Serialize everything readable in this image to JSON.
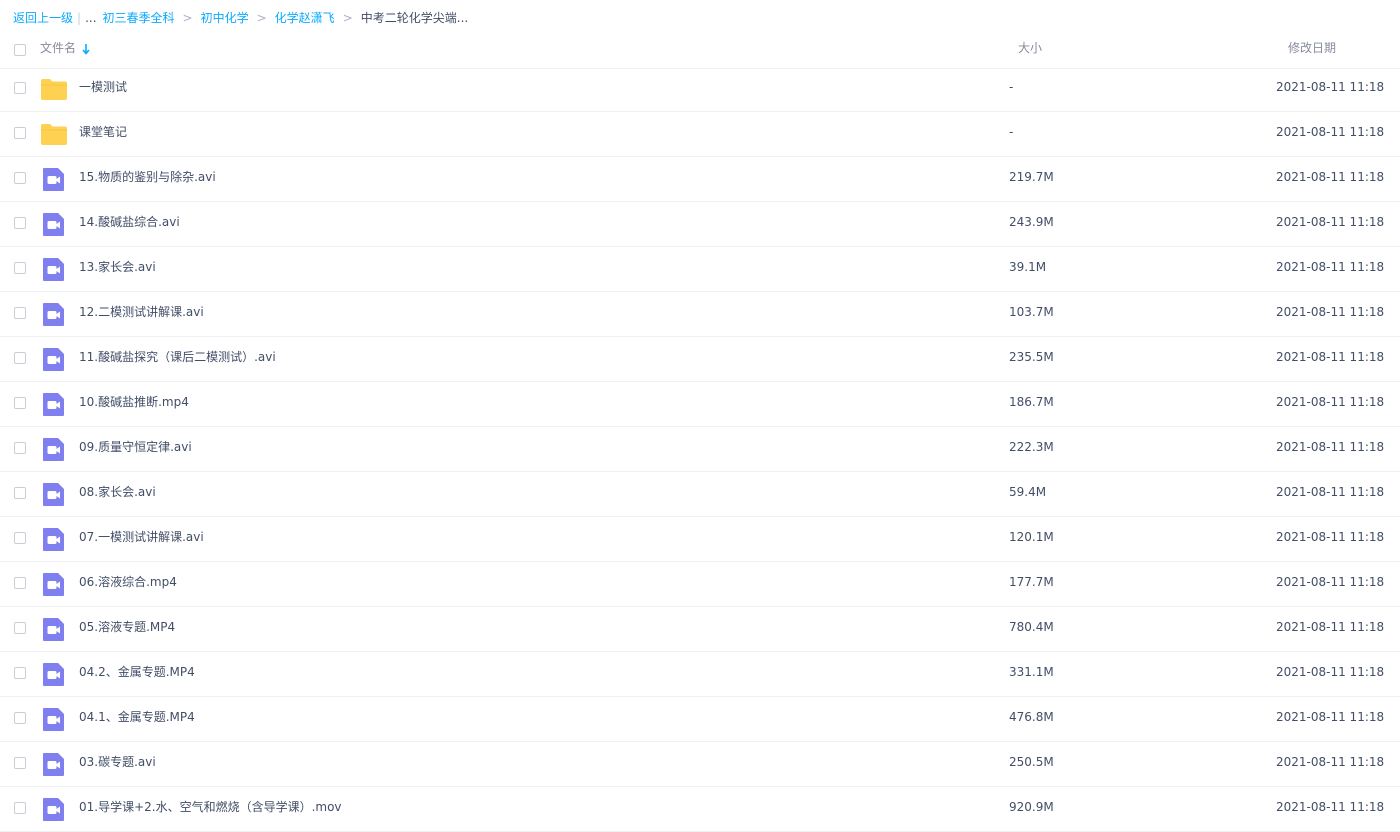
{
  "breadcrumb": {
    "back": "返回上一级",
    "separator_bar": "|",
    "ellipsis": "...",
    "sep": ">",
    "crumbs": [
      "初三春季全科",
      "初中化学",
      "化学赵潇飞"
    ],
    "current": "中考二轮化学尖端..."
  },
  "header": {
    "name": "文件名",
    "size": "大小",
    "date": "修改日期"
  },
  "colors": {
    "folder": "#ffd152",
    "video": "#7f7fef",
    "link": "#09aaff"
  },
  "files": [
    {
      "type": "folder",
      "icon": "folder-icon",
      "name": "一模测试",
      "size": "-",
      "date": "2021-08-11 11:18"
    },
    {
      "type": "folder",
      "icon": "folder-icon",
      "name": "课堂笔记",
      "size": "-",
      "date": "2021-08-11 11:18"
    },
    {
      "type": "video",
      "icon": "video-icon",
      "name": "15.物质的鉴别与除杂.avi",
      "size": "219.7M",
      "date": "2021-08-11 11:18"
    },
    {
      "type": "video",
      "icon": "video-icon",
      "name": "14.酸碱盐综合.avi",
      "size": "243.9M",
      "date": "2021-08-11 11:18"
    },
    {
      "type": "video",
      "icon": "video-icon",
      "name": "13.家长会.avi",
      "size": "39.1M",
      "date": "2021-08-11 11:18"
    },
    {
      "type": "video",
      "icon": "video-icon",
      "name": "12.二模测试讲解课.avi",
      "size": "103.7M",
      "date": "2021-08-11 11:18"
    },
    {
      "type": "video",
      "icon": "video-icon",
      "name": "11.酸碱盐探究（课后二模测试）.avi",
      "size": "235.5M",
      "date": "2021-08-11 11:18"
    },
    {
      "type": "video",
      "icon": "video-icon",
      "name": "10.酸碱盐推断.mp4",
      "size": "186.7M",
      "date": "2021-08-11 11:18"
    },
    {
      "type": "video",
      "icon": "video-icon",
      "name": "09.质量守恒定律.avi",
      "size": "222.3M",
      "date": "2021-08-11 11:18"
    },
    {
      "type": "video",
      "icon": "video-icon",
      "name": "08.家长会.avi",
      "size": "59.4M",
      "date": "2021-08-11 11:18"
    },
    {
      "type": "video",
      "icon": "video-icon",
      "name": "07.一模测试讲解课.avi",
      "size": "120.1M",
      "date": "2021-08-11 11:18"
    },
    {
      "type": "video",
      "icon": "video-icon",
      "name": "06.溶液综合.mp4",
      "size": "177.7M",
      "date": "2021-08-11 11:18"
    },
    {
      "type": "video",
      "icon": "video-icon",
      "name": "05.溶液专题.MP4",
      "size": "780.4M",
      "date": "2021-08-11 11:18"
    },
    {
      "type": "video",
      "icon": "video-icon",
      "name": "04.2、金属专题.MP4",
      "size": "331.1M",
      "date": "2021-08-11 11:18"
    },
    {
      "type": "video",
      "icon": "video-icon",
      "name": "04.1、金属专题.MP4",
      "size": "476.8M",
      "date": "2021-08-11 11:18"
    },
    {
      "type": "video",
      "icon": "video-icon",
      "name": "03.碳专题.avi",
      "size": "250.5M",
      "date": "2021-08-11 11:18"
    },
    {
      "type": "video",
      "icon": "video-icon",
      "name": "01.导学课+2.水、空气和燃烧（含导学课）.mov",
      "size": "920.9M",
      "date": "2021-08-11 11:18"
    }
  ]
}
